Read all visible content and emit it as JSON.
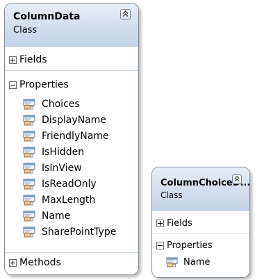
{
  "classes": [
    {
      "name": "ColumnData",
      "stereotype": "Class",
      "compartments": [
        {
          "label": "Fields",
          "expanded": false,
          "members": []
        },
        {
          "label": "Properties",
          "expanded": true,
          "members": [
            "Choices",
            "DisplayName",
            "FriendlyName",
            "IsHidden",
            "IsInView",
            "IsReadOnly",
            "MaxLength",
            "Name",
            "SharePointType"
          ]
        },
        {
          "label": "Methods",
          "expanded": false,
          "members": []
        }
      ]
    },
    {
      "name": "ColumnChoiceD...",
      "stereotype": "Class",
      "compartments": [
        {
          "label": "Fields",
          "expanded": false,
          "members": []
        },
        {
          "label": "Properties",
          "expanded": true,
          "members": [
            "Name"
          ]
        }
      ]
    }
  ],
  "icons": {
    "collapse": "double-chevron-up-icon",
    "expand_toggle": "plus-box-icon",
    "collapse_toggle": "minus-box-icon",
    "property": "property-hand-icon"
  },
  "colors": {
    "header_top": "#e8eef7",
    "header_bottom": "#c4d3ea",
    "border": "#7f8c9a"
  }
}
